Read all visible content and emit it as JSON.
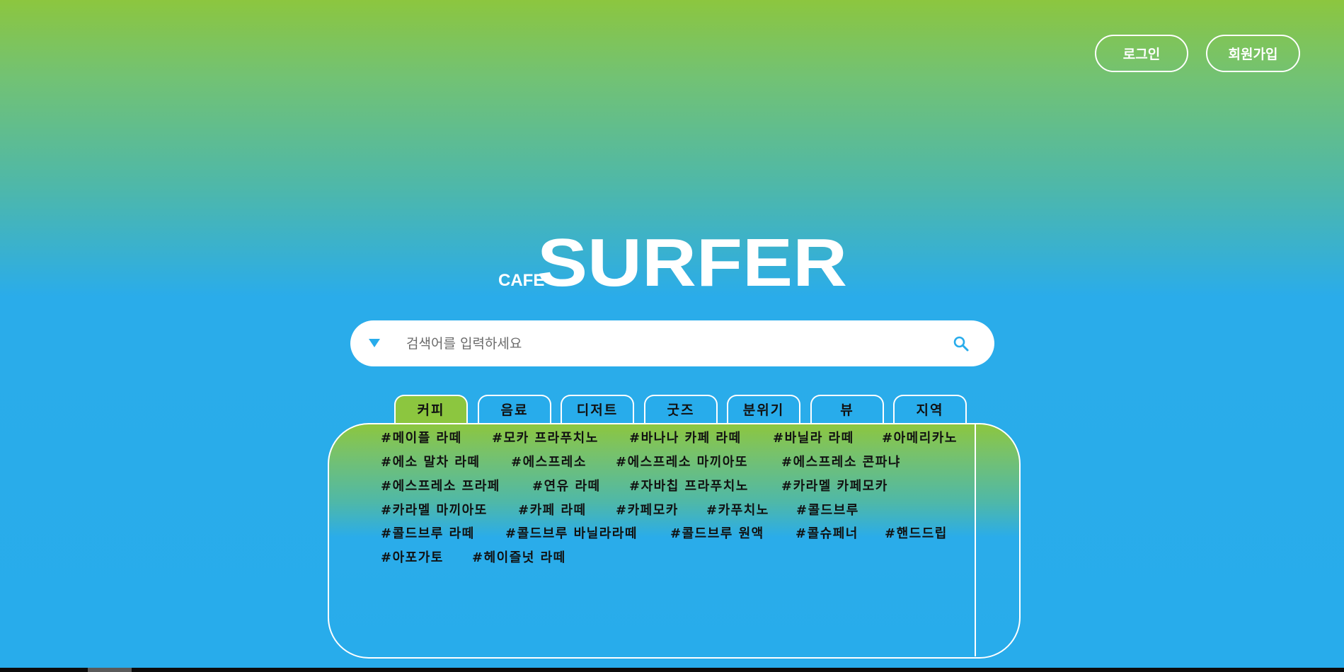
{
  "header": {
    "login_label": "로그인",
    "signup_label": "회원가입"
  },
  "logo": {
    "small_text": "CAFE",
    "large_text": "SURFER",
    "icon": "cafe-surfer-logo"
  },
  "search": {
    "placeholder": "검색어를 입력하세요",
    "value": "",
    "dropdown_icon": "triangle-down-icon",
    "search_icon": "magnifier-icon"
  },
  "tabs": [
    {
      "label": "커피",
      "active": true
    },
    {
      "label": "음료",
      "active": false
    },
    {
      "label": "디저트",
      "active": false
    },
    {
      "label": "굿즈",
      "active": false
    },
    {
      "label": "분위기",
      "active": false
    },
    {
      "label": "뷰",
      "active": false
    },
    {
      "label": "지역",
      "active": false
    }
  ],
  "tags": [
    [
      "#메이플 라떼",
      "#모카 프라푸치노",
      "#바나나 카페 라떼",
      "#바닐라 라떼",
      "#아메리카노"
    ],
    [
      "#에소 말차 라떼",
      "#에스프레소",
      "#에스프레소 마끼아또",
      "#에스프레소 콘파냐"
    ],
    [
      "#에스프레소 프라페",
      "#연유 라떼",
      "#자바칩 프라푸치노",
      "#카라멜 카페모카"
    ],
    [
      "#카라멜 마끼아또",
      "#카페 라떼",
      "#카페모카",
      "#카푸치노",
      "#콜드브루"
    ],
    [
      "#콜드브루 라떼",
      "#콜드브루 바닐라라떼",
      "#콜드브루 원액",
      "#콜슈페너",
      "#핸드드립"
    ],
    [
      "#아포가토",
      "#헤이즐넛 라떼"
    ]
  ],
  "colors": {
    "green": "#8cc63f",
    "blue": "#28aceb",
    "white": "#ffffff",
    "text": "#111111"
  }
}
